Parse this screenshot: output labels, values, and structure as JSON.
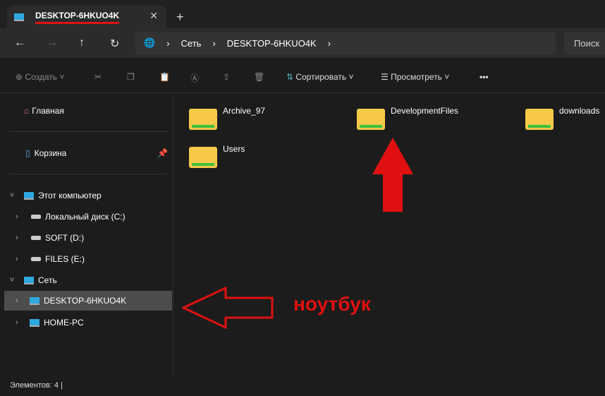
{
  "tab": {
    "title": "DESKTOP-6HKUO4K",
    "close": "✕",
    "new": "+"
  },
  "nav": {
    "back": "←",
    "forward": "→",
    "up": "↑",
    "refresh": "↻",
    "crumbs": [
      "Сеть",
      "DESKTOP-6HKUO4K"
    ],
    "search_placeholder": "Поиск"
  },
  "toolbar": {
    "create": "Создать",
    "sort": "Сортировать",
    "view": "Просмотреть",
    "more": "•••"
  },
  "sidebar": {
    "home": "Главная",
    "trash": "Корзина",
    "pc": "Этот компьютер",
    "drives": [
      "Локальный диск (C:)",
      "SOFT (D:)",
      "FILES (E:)"
    ],
    "network": "Сеть",
    "hosts": [
      "DESKTOP-6HKUO4K",
      "HOME-PC"
    ]
  },
  "files": [
    "Archive_97",
    "DevelopmentFiles",
    "downloads",
    "Users"
  ],
  "status": "Элементов: 4",
  "annotation": "ноутбук"
}
